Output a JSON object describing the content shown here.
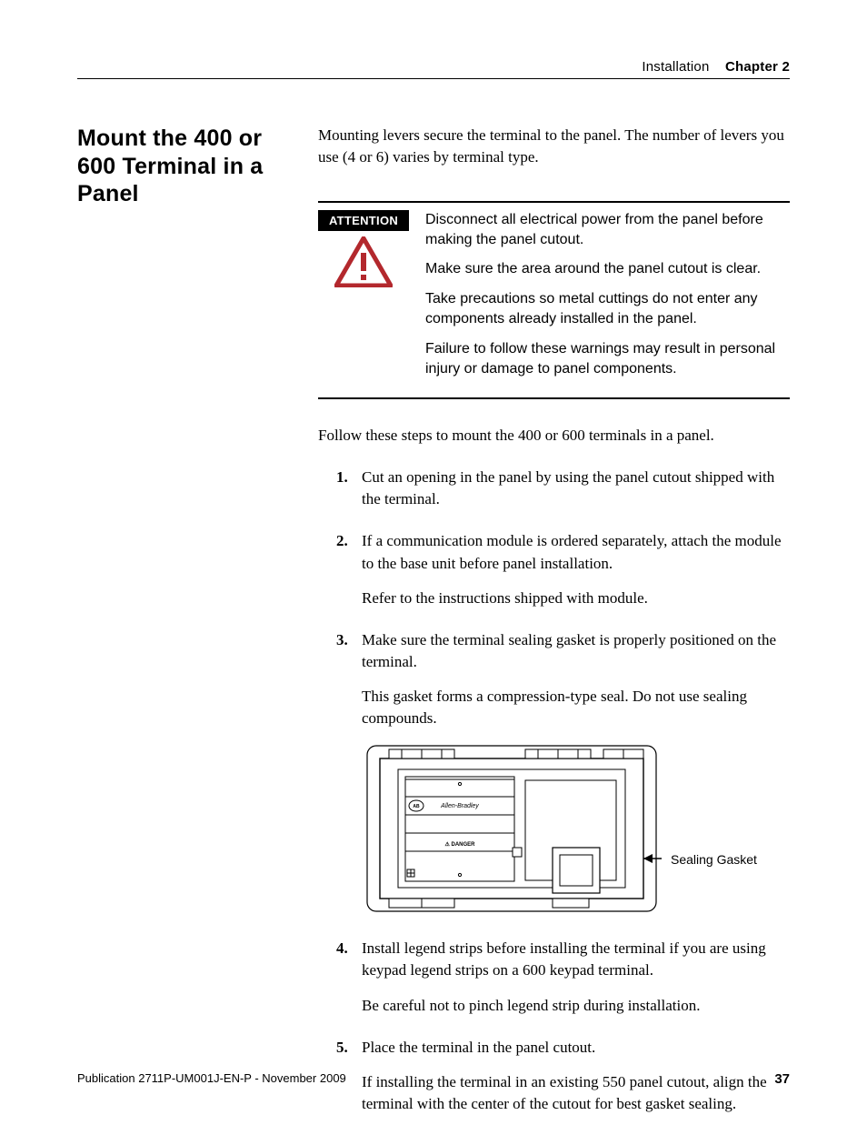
{
  "header": {
    "section": "Installation",
    "chapter": "Chapter 2"
  },
  "title": "Mount the 400 or 600 Terminal in a Panel",
  "intro": "Mounting levers secure the terminal to the panel. The number of levers you use (4 or 6) varies by terminal type.",
  "attention": {
    "label": "ATTENTION",
    "lines": [
      "Disconnect all electrical power from the panel before making the panel cutout.",
      "Make sure the area around the panel cutout is clear.",
      "Take precautions so metal cuttings do not enter any components already installed in the panel.",
      "Failure to follow these warnings may result in personal injury or damage to panel components."
    ]
  },
  "follow": "Follow these steps to mount the 400 or 600 terminals in a panel.",
  "steps": [
    {
      "main": "Cut an opening in the panel by using the panel cutout shipped with the terminal."
    },
    {
      "main": "If a communication module is ordered separately, attach the module to the base unit before panel installation.",
      "sub": "Refer to the instructions shipped with module."
    },
    {
      "main": "Make sure the terminal sealing gasket is properly positioned on the terminal.",
      "sub": "This gasket forms a compression-type seal. Do not use sealing compounds."
    },
    {
      "main": "Install legend strips before installing the terminal if you are using keypad legend strips on a 600 keypad terminal.",
      "sub": "Be careful not to pinch legend strip during installation."
    },
    {
      "main": "Place the terminal in the panel cutout.",
      "sub": "If installing the terminal in an existing 550 panel cutout, align the terminal with the center of the cutout for best gasket sealing."
    }
  ],
  "figure": {
    "brand": "Allen-Bradley",
    "danger_label": "DANGER",
    "callout": "Sealing Gasket"
  },
  "footer": {
    "publication": "Publication 2711P-UM001J-EN-P - November 2009",
    "page": "37"
  }
}
